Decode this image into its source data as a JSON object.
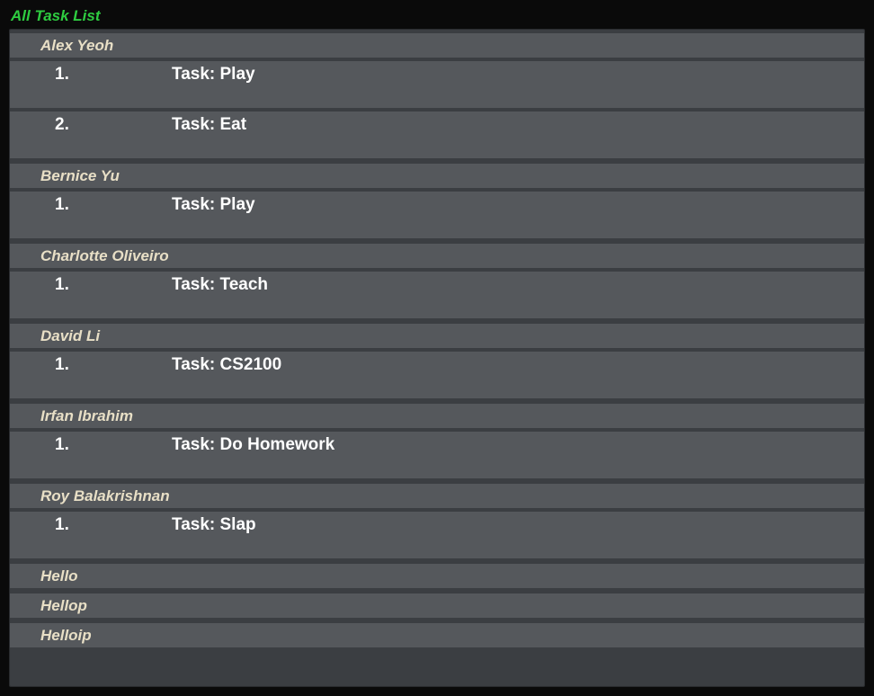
{
  "title": "All Task List",
  "taskPrefix": "Task: ",
  "groups": [
    {
      "name": "Alex Yeoh",
      "tasks": [
        "Play",
        "Eat"
      ]
    },
    {
      "name": "Bernice Yu",
      "tasks": [
        "Play"
      ]
    },
    {
      "name": "Charlotte Oliveiro",
      "tasks": [
        "Teach"
      ]
    },
    {
      "name": "David Li",
      "tasks": [
        "CS2100"
      ]
    },
    {
      "name": "Irfan Ibrahim",
      "tasks": [
        "Do Homework"
      ]
    },
    {
      "name": "Roy Balakrishnan",
      "tasks": [
        "Slap"
      ]
    },
    {
      "name": "Hello",
      "tasks": []
    },
    {
      "name": "Hellop",
      "tasks": []
    },
    {
      "name": "Helloip",
      "tasks": []
    }
  ]
}
